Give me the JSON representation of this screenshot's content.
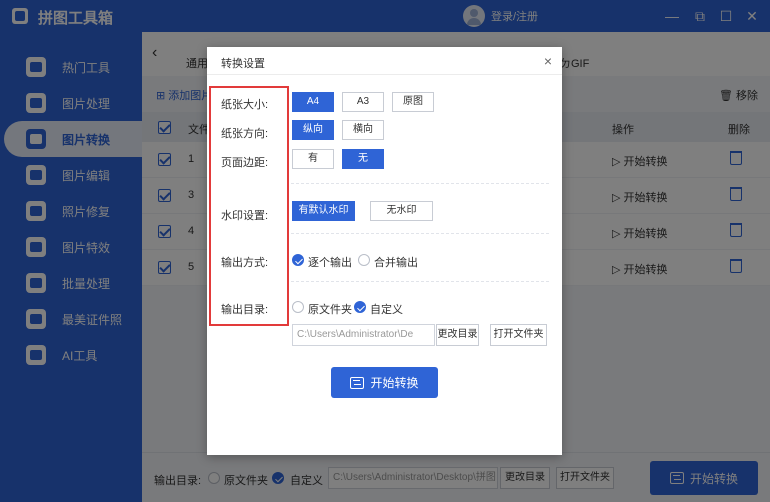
{
  "app": {
    "title": "拼图工具箱",
    "user_label": "登录/注册"
  },
  "window": {
    "minimize": "—",
    "restore": "⧉",
    "maximize": "☐",
    "close": "✕"
  },
  "sidebar": {
    "items": [
      {
        "label": "热门工具",
        "icon": "tools-icon"
      },
      {
        "label": "图片处理",
        "icon": "image-process-icon"
      },
      {
        "label": "图片转换",
        "icon": "image-convert-icon",
        "active": true
      },
      {
        "label": "图片编辑",
        "icon": "image-edit-icon"
      },
      {
        "label": "照片修复",
        "icon": "photo-repair-icon"
      },
      {
        "label": "图片特效",
        "icon": "image-effect-icon"
      },
      {
        "label": "批量处理",
        "icon": "batch-icon"
      },
      {
        "label": "最美证件照",
        "icon": "id-photo-icon"
      },
      {
        "label": "AI工具",
        "icon": "ai-icon"
      }
    ]
  },
  "main": {
    "tab_first": "通用",
    "tab_last": "ㄉGIF",
    "add_label": "添加图片",
    "remove_label": "移除",
    "columns": {
      "file": "文件",
      "operation": "操作",
      "delete": "删除"
    },
    "rows": [
      {
        "num": "1",
        "op": "▷ 开始转换"
      },
      {
        "num": "3",
        "op": "▷ 开始转换"
      },
      {
        "num": "4",
        "op": "▷ 开始转换"
      },
      {
        "num": "5",
        "op": "▷ 开始转换"
      }
    ],
    "bottom": {
      "output_label": "输出目录:",
      "orig_folder": "原文件夹",
      "custom": "自定义",
      "path": "C:\\Users\\Administrator\\Desktop\\拼图",
      "change_dir": "更改目录",
      "open_folder": "打开文件夹",
      "start": "开始转换"
    }
  },
  "dialog": {
    "title": "转换设置",
    "close": "×",
    "paper_size": {
      "label": "纸张大小:",
      "options": [
        "A4",
        "A3",
        "原图"
      ],
      "selected": "A4"
    },
    "orientation": {
      "label": "纸张方向:",
      "options": [
        "纵向",
        "横向"
      ],
      "selected": "纵向"
    },
    "margin": {
      "label": "页面边距:",
      "options": [
        "有",
        "无"
      ],
      "selected": "无"
    },
    "watermark": {
      "label": "水印设置:",
      "options": [
        "有默认水印",
        "无水印"
      ],
      "selected": "有默认水印"
    },
    "output_mode": {
      "label": "输出方式:",
      "options": [
        "逐个输出",
        "合并输出"
      ],
      "selected": "逐个输出"
    },
    "output_dir": {
      "label": "输出目录:",
      "options": [
        "原文件夹",
        "自定义"
      ],
      "selected": "自定义",
      "path": "C:\\Users\\Administrator\\De",
      "change_dir": "更改目录",
      "open_folder": "打开文件夹"
    },
    "start": "开始转换"
  }
}
